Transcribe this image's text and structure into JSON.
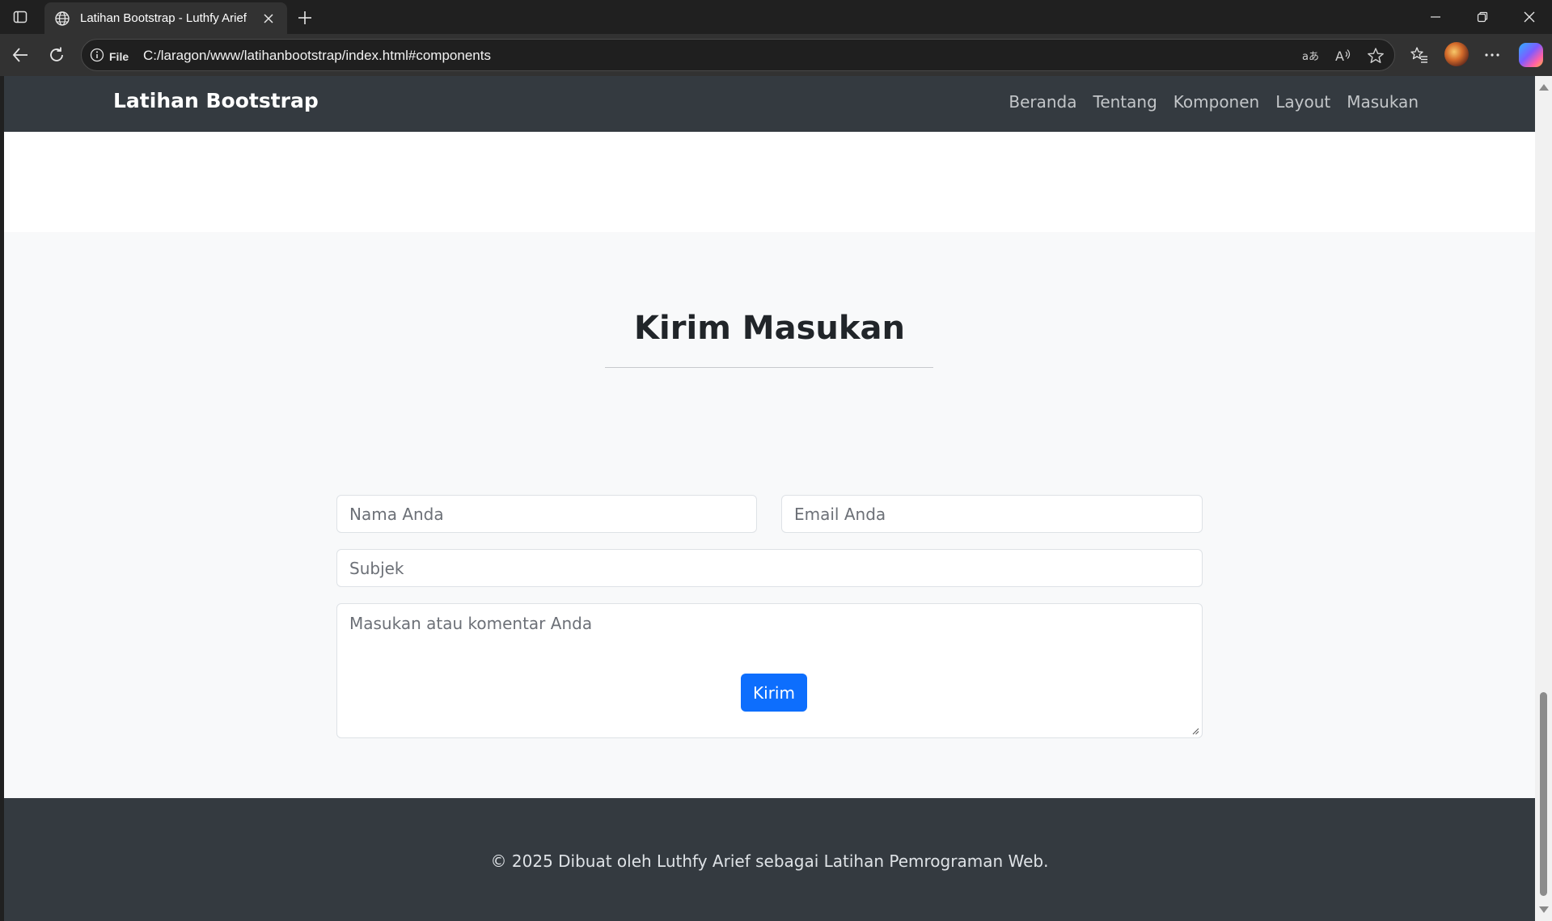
{
  "browser": {
    "tab_title": "Latihan Bootstrap - Luthfy Arief",
    "address": {
      "scheme_label": "File",
      "url": "C:/laragon/www/latihanbootstrap/index.html#components"
    },
    "icons": {
      "tab_actions": "tab-actions-icon",
      "tab_favicon": "globe-icon",
      "tab_close": "close-icon",
      "new_tab": "plus-icon",
      "back": "arrow-left-icon",
      "refresh": "refresh-icon",
      "site_info": "info-icon",
      "translate": "translate-icon",
      "read_aloud": "read-aloud-icon",
      "favorite": "star-icon",
      "favorites": "favorites-icon",
      "profile": "avatar",
      "more": "more-icon",
      "copilot": "copilot-icon",
      "minimize": "minimize-icon",
      "restore": "restore-icon",
      "close_window": "close-icon"
    }
  },
  "page": {
    "navbar": {
      "brand": "Latihan Bootstrap",
      "links": [
        "Beranda",
        "Tentang",
        "Komponen",
        "Layout",
        "Masukan"
      ]
    },
    "feedback": {
      "title": "Kirim Masukan",
      "name_placeholder": "Nama Anda",
      "email_placeholder": "Email Anda",
      "subject_placeholder": "Subjek",
      "message_placeholder": "Masukan atau komentar Anda",
      "submit_label": "Kirim"
    },
    "footer": {
      "text": "© 2025 Dibuat oleh Luthfy Arief sebagai Latihan Pemrograman Web."
    },
    "colors": {
      "navbar_bg": "#343a40",
      "section_bg": "#f8f9fa",
      "primary": "#0d6efd",
      "text_dark": "#212529"
    }
  }
}
